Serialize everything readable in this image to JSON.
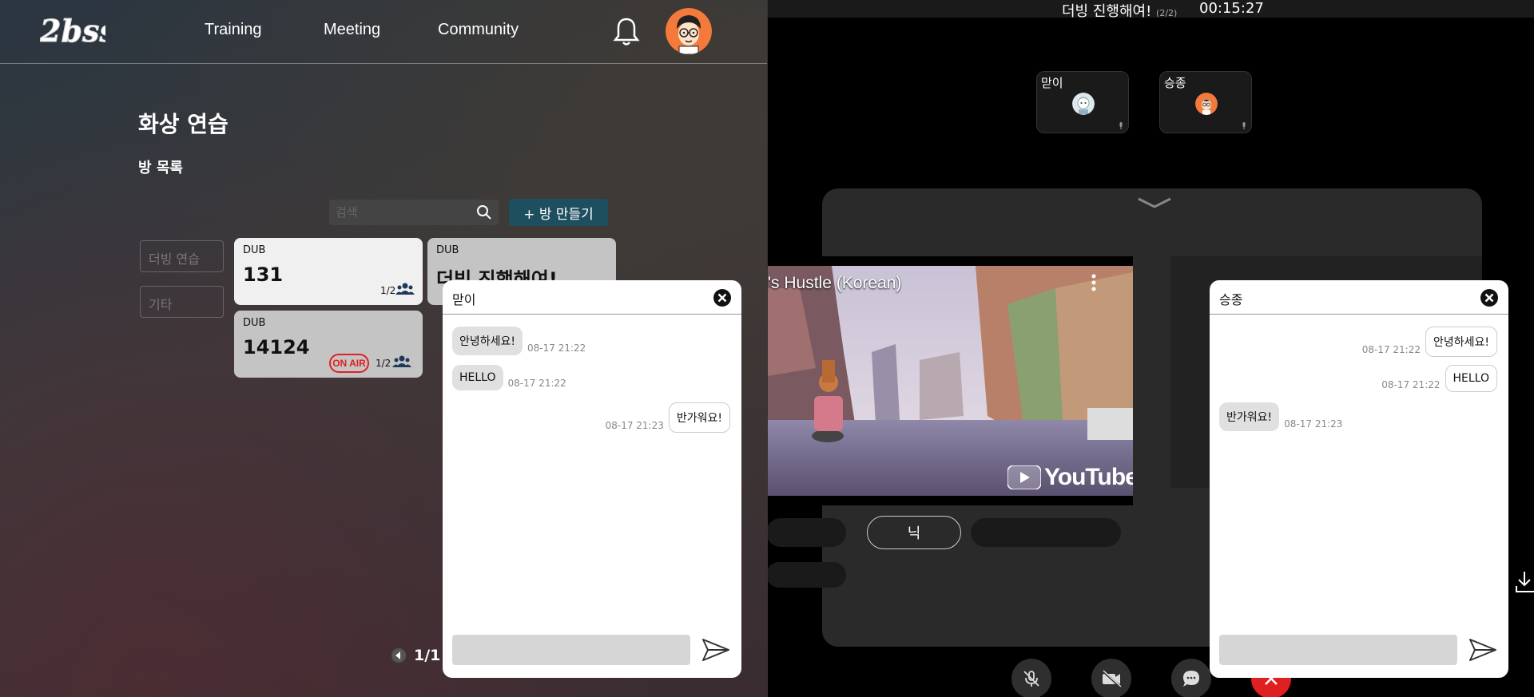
{
  "nav": {
    "logo_text": "2bss",
    "links": [
      "Training",
      "Meeting",
      "Community"
    ]
  },
  "page": {
    "title": "화상 연습",
    "section": "방 목록"
  },
  "search": {
    "placeholder": "검색"
  },
  "create_button": "+ 방 만들기",
  "filters": [
    "더빙 연습",
    "기타"
  ],
  "rooms": [
    {
      "type": "DUB",
      "name": "131",
      "count": "1/2",
      "on_air": false
    },
    {
      "type": "DUB",
      "name": "더빙 진행해여!",
      "count": "",
      "on_air": false
    },
    {
      "type": "DUB",
      "name": "14124",
      "count": "1/2",
      "on_air": true,
      "on_air_label": "ON AIR"
    }
  ],
  "pager": {
    "text": "1/1"
  },
  "chat_left": {
    "title": "맏이",
    "messages": [
      {
        "text": "안녕하세요!",
        "time": "08-17 21:22",
        "mine": false
      },
      {
        "text": "HELLO",
        "time": "08-17 21:22",
        "mine": false
      },
      {
        "text": "반가워요!",
        "time": "08-17 21:23",
        "mine": true
      }
    ]
  },
  "chat_right": {
    "title": "승종",
    "messages": [
      {
        "text": "안녕하세요!",
        "time": "08-17 21:22",
        "mine": true
      },
      {
        "text": "HELLO",
        "time": "08-17 21:22",
        "mine": true
      },
      {
        "text": "반가워요!",
        "time": "08-17 21:23",
        "mine": false
      }
    ]
  },
  "session": {
    "title": "더빙 진행해여!",
    "count": "(2/2)",
    "timer": "00:15:27"
  },
  "participants": [
    {
      "name": "맏이"
    },
    {
      "name": "승종"
    }
  ],
  "video": {
    "title": "'s Hustle (Korean)",
    "brand": "YouTube"
  },
  "role_chip": "닉",
  "colors": {
    "accent": "#1e4f5f",
    "on_air": "#e02020",
    "end_call": "#e02020"
  }
}
